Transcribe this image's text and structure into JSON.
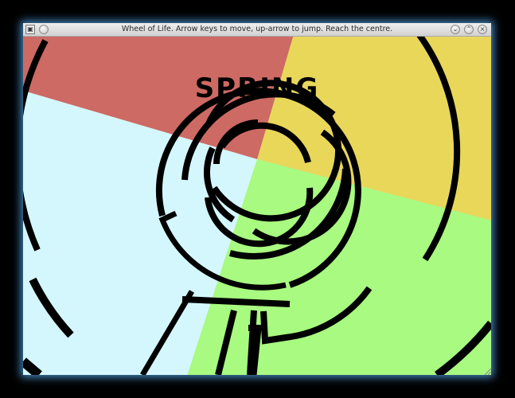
{
  "window": {
    "title": "Wheel of Life. Arrow keys to move, up-arrow to jump. Reach the centre."
  },
  "titlebar": {
    "app_icon": "app-menu-icon",
    "pin_icon": "pin-icon",
    "buttons": [
      "minimize-icon",
      "maximize-icon",
      "close-icon"
    ]
  },
  "game": {
    "season_label": "SPRING",
    "colors": {
      "summer": "#e9d75a",
      "spring": "#cd6a63",
      "winter": "#d4f7fe",
      "autumn": "#a8fa80",
      "wall": "#000000"
    }
  }
}
